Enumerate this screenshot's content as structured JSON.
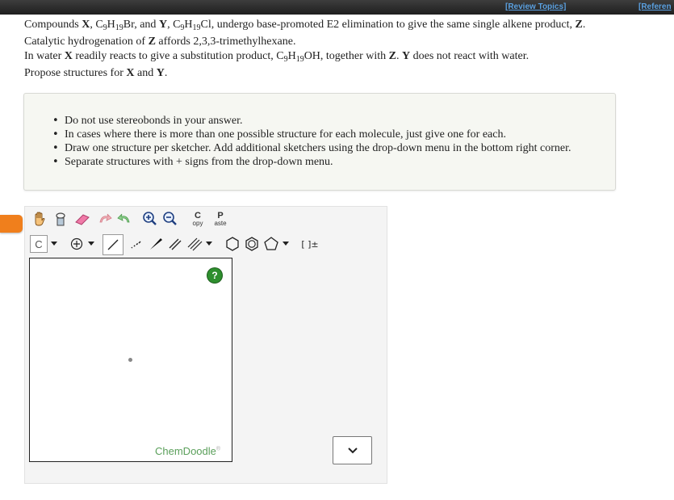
{
  "topbar": {
    "review_link": "[Review Topics]",
    "references_link": "[Referen"
  },
  "question": {
    "line1": {
      "a": "Compounds ",
      "x": "X",
      "b": ", C",
      "c9": "9",
      "h": "H",
      "h19": "19",
      "br": "Br, and ",
      "y": "Y",
      "d": ", C",
      "c9b": "9",
      "h2": "H",
      "h19b": "19",
      "cl": "Cl, undergo base-promoted E2 elimination to give the same single alkene product, ",
      "z": "Z",
      "end": "."
    },
    "line2": {
      "a": "Catalytic hydrogenation of ",
      "z": "Z",
      "b": " affords 2,3,3-trimethylhexane."
    },
    "line3": {
      "a": "In water ",
      "x": "X",
      "b": " readily reacts to give a substitution product, C",
      "c9": "9",
      "h": "H",
      "h19": "19",
      "c": "OH, together with ",
      "z": "Z",
      "d": ". ",
      "y": "Y",
      "e": " does not react with water."
    },
    "line4": {
      "a": "Propose structures for ",
      "x": "X",
      "b": " and ",
      "y": "Y",
      "end": "."
    }
  },
  "instructions": [
    "Do not use stereobonds in your answer.",
    "In cases where there is more than one possible structure for each molecule, just give one for each.",
    "Draw one structure per sketcher. Add additional sketchers using the drop-down menu in the bottom right corner.",
    "Separate structures with + signs from the drop-down menu."
  ],
  "toolbar": {
    "copy_letter": "C",
    "copy_label": "opy",
    "paste_letter": "P",
    "paste_label": "aste",
    "element": "C",
    "charge_brackets": "[ ]±"
  },
  "sketcher": {
    "help": "?",
    "brand": "ChemDoodle",
    "brand_mark": "®"
  },
  "colors": {
    "accent_orange": "#f07f1c",
    "help_green": "#2e8f2e",
    "link_blue": "#5aa0e0"
  }
}
